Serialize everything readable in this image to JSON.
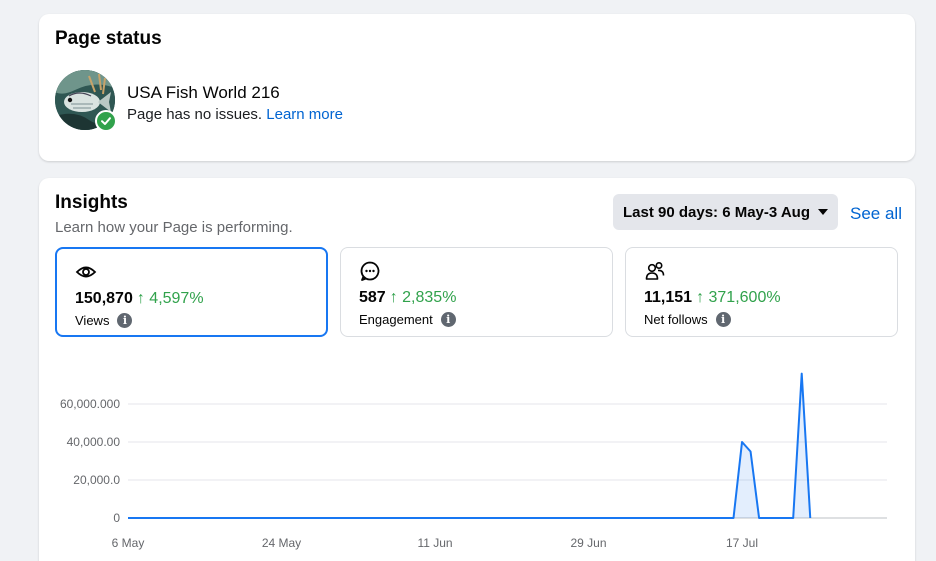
{
  "page_status": {
    "title": "Page status",
    "page_name": "USA Fish World 216",
    "status_text": "Page has no issues.",
    "learn_more": "Learn more"
  },
  "insights": {
    "title": "Insights",
    "subtitle": "Learn how your Page is performing.",
    "date_range": "Last 90 days: 6 May-3 Aug",
    "see_all": "See all",
    "metrics": [
      {
        "value": "150,870",
        "delta": "↑ 4,597%",
        "label": "Views",
        "icon": "eye-icon"
      },
      {
        "value": "587",
        "delta": "↑ 2,835%",
        "label": "Engagement",
        "icon": "chat-bubble-icon"
      },
      {
        "value": "11,151",
        "delta": "↑ 371,600%",
        "label": "Net follows",
        "icon": "people-icon"
      }
    ]
  },
  "colors": {
    "accent": "#1877f2",
    "link": "#0064d1",
    "positive": "#31a24c"
  },
  "chart_data": {
    "type": "area",
    "series_name": "Views",
    "ylim": [
      0,
      80000
    ],
    "y_ticks": [
      0,
      20000,
      40000,
      60000
    ],
    "y_tick_labels": [
      "0",
      "20,000.0",
      "40,000.00",
      "60,000.000"
    ],
    "x_range": [
      0,
      89
    ],
    "x_tick_positions": [
      0,
      18,
      36,
      54,
      72
    ],
    "x_tick_labels": [
      "6 May",
      "24 May",
      "11 Jun",
      "29 Jun",
      "17 Jul"
    ],
    "points": [
      [
        0,
        0
      ],
      [
        71,
        0
      ],
      [
        72,
        40000
      ],
      [
        73,
        35000
      ],
      [
        74,
        0
      ],
      [
        78,
        0
      ],
      [
        79,
        76000
      ],
      [
        80,
        0
      ]
    ]
  }
}
